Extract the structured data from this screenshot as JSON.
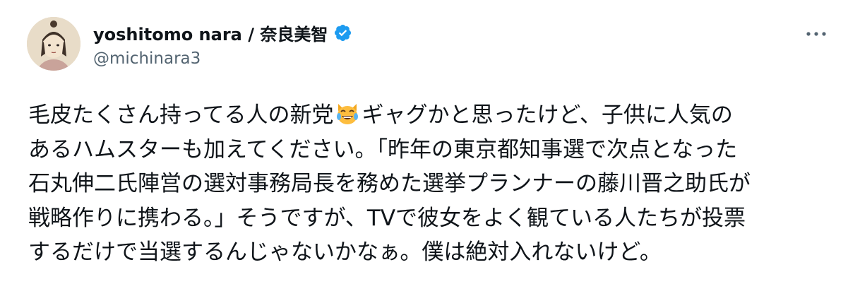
{
  "author": {
    "display_name": "yoshitomo nara / 奈良美智",
    "handle": "@michinara3",
    "verified": true,
    "avatar": "avatar-painting-girl"
  },
  "header": {
    "more_icon": "more-horizontal-icon",
    "verified_icon": "verified-badge-icon"
  },
  "tweet": {
    "lines": [
      "毛皮たくさん持ってる人の新党",
      "ギャグかと思ったけど、子供に人気の",
      "あるハムスターも加えてください。「昨年の東京都知事選で次点となった",
      "石丸伸二氏陣営の選対事務局長を務めた選挙プランナーの藤川晋之助氏が",
      "戦略作りに携わる。」そうですが、TVで彼女をよく観ている人たちが投票",
      "するだけで当選するんじゃないかなぁ。僕は絶対入れないけど。"
    ],
    "emoji": "crying-laughing-cat-emoji"
  },
  "colors": {
    "text": "#0f1419",
    "secondary": "#536471",
    "verified_blue": "#1d9bf0"
  }
}
